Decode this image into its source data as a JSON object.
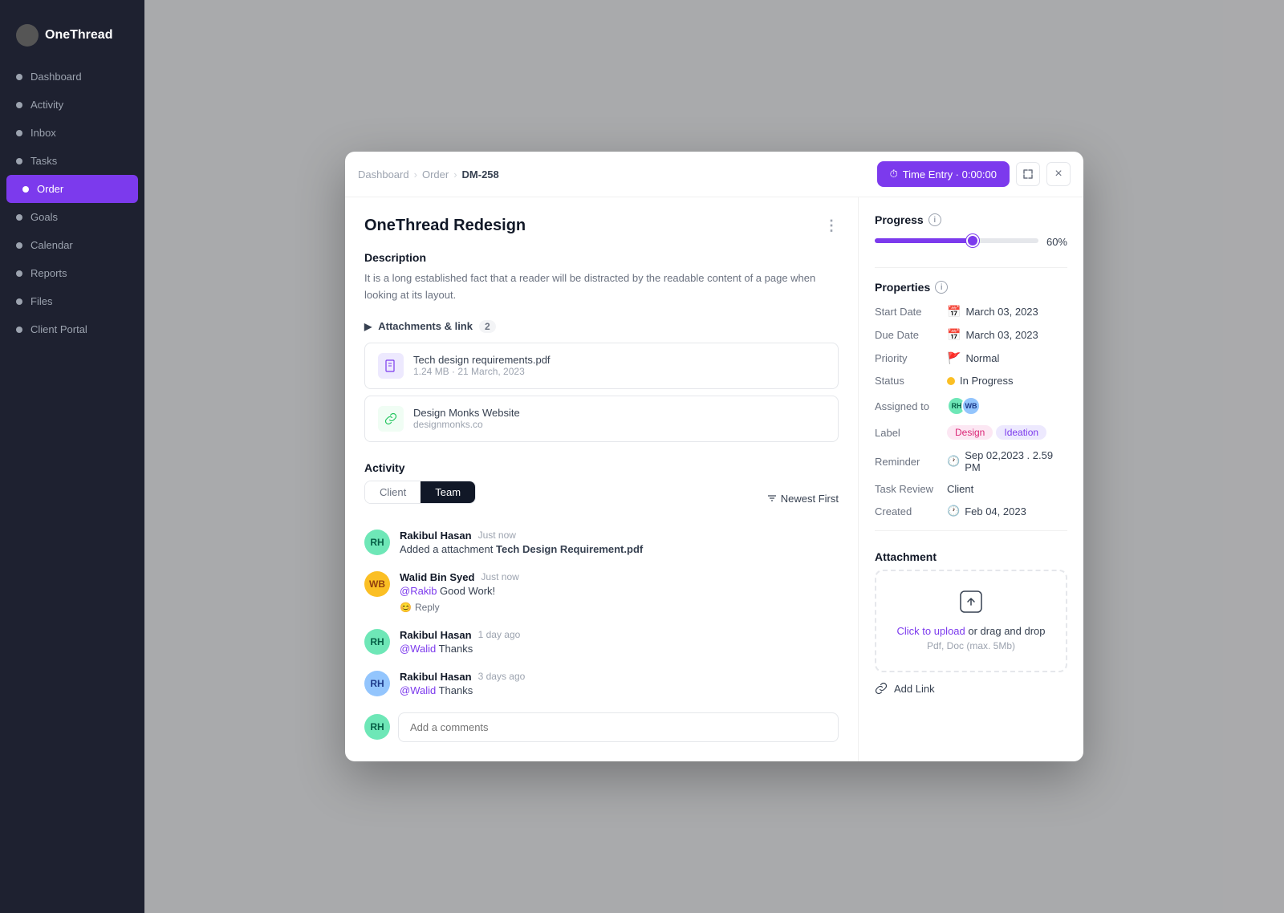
{
  "sidebar": {
    "logo": "OneThread",
    "items": [
      {
        "label": "Dashboard",
        "active": false
      },
      {
        "label": "Activity",
        "active": false
      },
      {
        "label": "Inbox",
        "active": false
      },
      {
        "label": "Tasks",
        "active": false
      },
      {
        "label": "Order",
        "active": true
      },
      {
        "label": "Goals",
        "active": false
      },
      {
        "label": "Calendar",
        "active": false
      },
      {
        "label": "Reports",
        "active": false
      },
      {
        "label": "Files",
        "active": false
      },
      {
        "label": "Client Portal",
        "active": false
      }
    ]
  },
  "modal": {
    "breadcrumb": {
      "items": [
        "Dashboard",
        "Order"
      ],
      "current": "DM-258"
    },
    "time_entry_button": "Time Entry · 0:00:00",
    "task_title": "OneThread Redesign",
    "description_label": "Description",
    "description_text": "It is a long established fact that a reader will be distracted by the readable content of a page when looking at its layout.",
    "attachments_label": "Attachments & link",
    "attachments_count": "2",
    "attachments": [
      {
        "type": "file",
        "name": "Tech design requirements.pdf",
        "meta": "1.24 MB · 21 March, 2023"
      },
      {
        "type": "link",
        "name": "Design Monks Website",
        "meta": "designmonks.co"
      }
    ],
    "activity_label": "Activity",
    "activity_tabs": [
      "Client",
      "Team"
    ],
    "active_tab": "Team",
    "sort_label": "Newest First",
    "comments": [
      {
        "author": "Rakibul Hasan",
        "time": "Just now",
        "text": "Added a attachment Tech Design Requirement.pdf",
        "avatar_color": "green",
        "avatar_initials": "RH",
        "has_reply": false
      },
      {
        "author": "Walid Bin Syed",
        "time": "Just now",
        "text": "@Rakib Good Work!",
        "avatar_color": "orange",
        "avatar_initials": "WB",
        "has_reply": true
      },
      {
        "author": "Rakibul Hasan",
        "time": "1 day ago",
        "text": "@Walid Thanks",
        "avatar_color": "green",
        "avatar_initials": "RH",
        "has_reply": false
      },
      {
        "author": "Rakibul Hasan",
        "time": "3 days ago",
        "text": "@Walid Thanks",
        "avatar_color": "green",
        "avatar_initials": "RH",
        "has_reply": false
      }
    ],
    "comment_placeholder": "Add a comments",
    "progress_label": "Progress",
    "progress_value": 60,
    "progress_display": "60%",
    "properties_label": "Properties",
    "properties": {
      "start_date": "March 03, 2023",
      "due_date": "March 03, 2023",
      "priority": "Normal",
      "status": "In Progress",
      "task_review": "Client",
      "created": "Feb 04, 2023",
      "reminder": "Sep 02,2023 . 2.59 PM",
      "labels": [
        "Design",
        "Ideation"
      ]
    },
    "attachment_section_label": "Attachment",
    "upload_text_link": "Click to upload",
    "upload_text_rest": " or drag and drop",
    "upload_hint": "Pdf, Doc  (max. 5Mb)",
    "add_link_label": "Add Link"
  }
}
